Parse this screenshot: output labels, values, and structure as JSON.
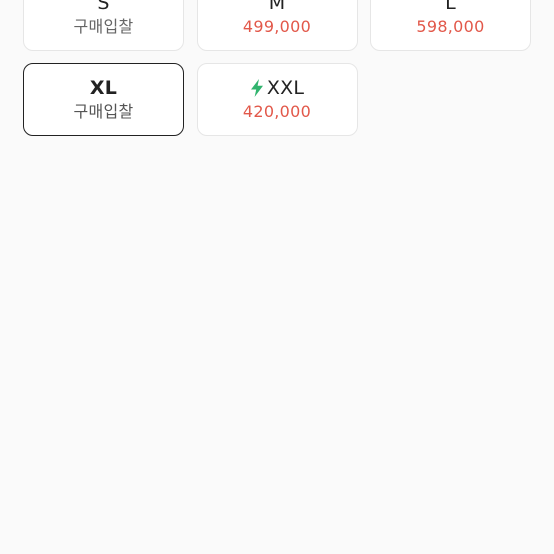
{
  "sizes": [
    {
      "label": "S",
      "price": "구매입찰",
      "fast": false,
      "selected": false,
      "price_color": "gray"
    },
    {
      "label": "M",
      "price": "499,000",
      "fast": false,
      "selected": false,
      "price_color": "red"
    },
    {
      "label": "L",
      "price": "598,000",
      "fast": false,
      "selected": false,
      "price_color": "red"
    },
    {
      "label": "XL",
      "price": "구매입찰",
      "fast": false,
      "selected": true,
      "price_color": "gray"
    },
    {
      "label": "XXL",
      "price": "420,000",
      "fast": true,
      "selected": false,
      "price_color": "red",
      "icon": "lightning-bolt-icon"
    }
  ],
  "colors": {
    "price_red": "#e2584a",
    "fast_green": "#31b46e",
    "selected_border": "#222222"
  }
}
